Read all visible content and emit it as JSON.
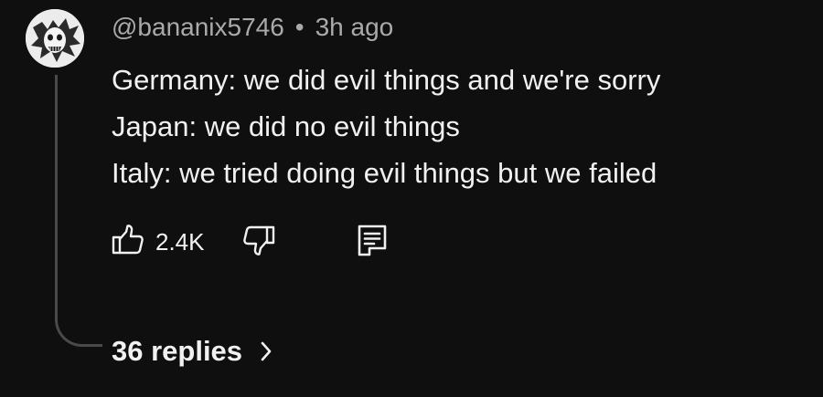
{
  "comment": {
    "author": "@bananix5746",
    "separator": "•",
    "time": "3h ago",
    "text_lines": [
      "Germany: we did evil things and we're sorry",
      "Japan: we did no evil things",
      "Italy: we tried doing evil things but we failed"
    ],
    "like_count": "2.4K",
    "replies_label": "36 replies"
  },
  "icons": {
    "avatar": "avatar-image",
    "like": "thumbs-up-icon",
    "dislike": "thumbs-down-icon",
    "reply": "reply-comment-icon",
    "expand": "chevron-right-icon"
  },
  "colors": {
    "background": "#0f0f0f",
    "text_primary": "#f1f1f1",
    "text_secondary": "#aaaaaa",
    "thread_line": "#4a4a4a"
  }
}
